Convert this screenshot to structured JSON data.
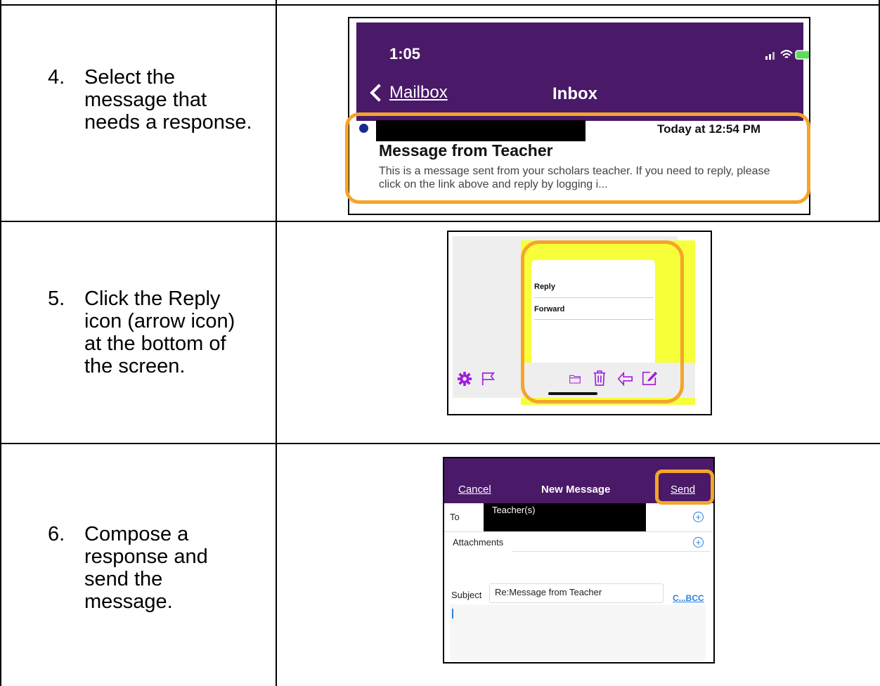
{
  "steps": [
    {
      "num": "4.",
      "text": "Select the message that needs a response."
    },
    {
      "num": "5.",
      "text": "Click the Reply icon (arrow icon) at the bottom of the screen."
    },
    {
      "num": "6.",
      "text": "Compose a response and send the message."
    }
  ],
  "inbox": {
    "time": "1:05",
    "back_label": "Mailbox",
    "title": "Inbox",
    "date": "Today at 12:54 PM",
    "subject": "Message from Teacher",
    "preview": "This is a message sent from your scholars teacher. If you need to reply, please click on the link above and reply by logging i..."
  },
  "reply_menu": {
    "items": [
      "Reply",
      "Forward"
    ]
  },
  "compose": {
    "cancel": "Cancel",
    "title": "New Message",
    "send": "Send",
    "to_label": "To",
    "to_value": "Teacher(s)",
    "attachments_label": "Attachments",
    "subject_label": "Subject",
    "subject_value": "Re:Message from Teacher",
    "cc_bcc": "C...BCC"
  },
  "colors": {
    "purple": "#4a1968",
    "highlight": "#f4a52a",
    "icon_purple": "#a11ed8",
    "yellow": "#f6ff3a",
    "link_blue": "#2a7ee0"
  }
}
